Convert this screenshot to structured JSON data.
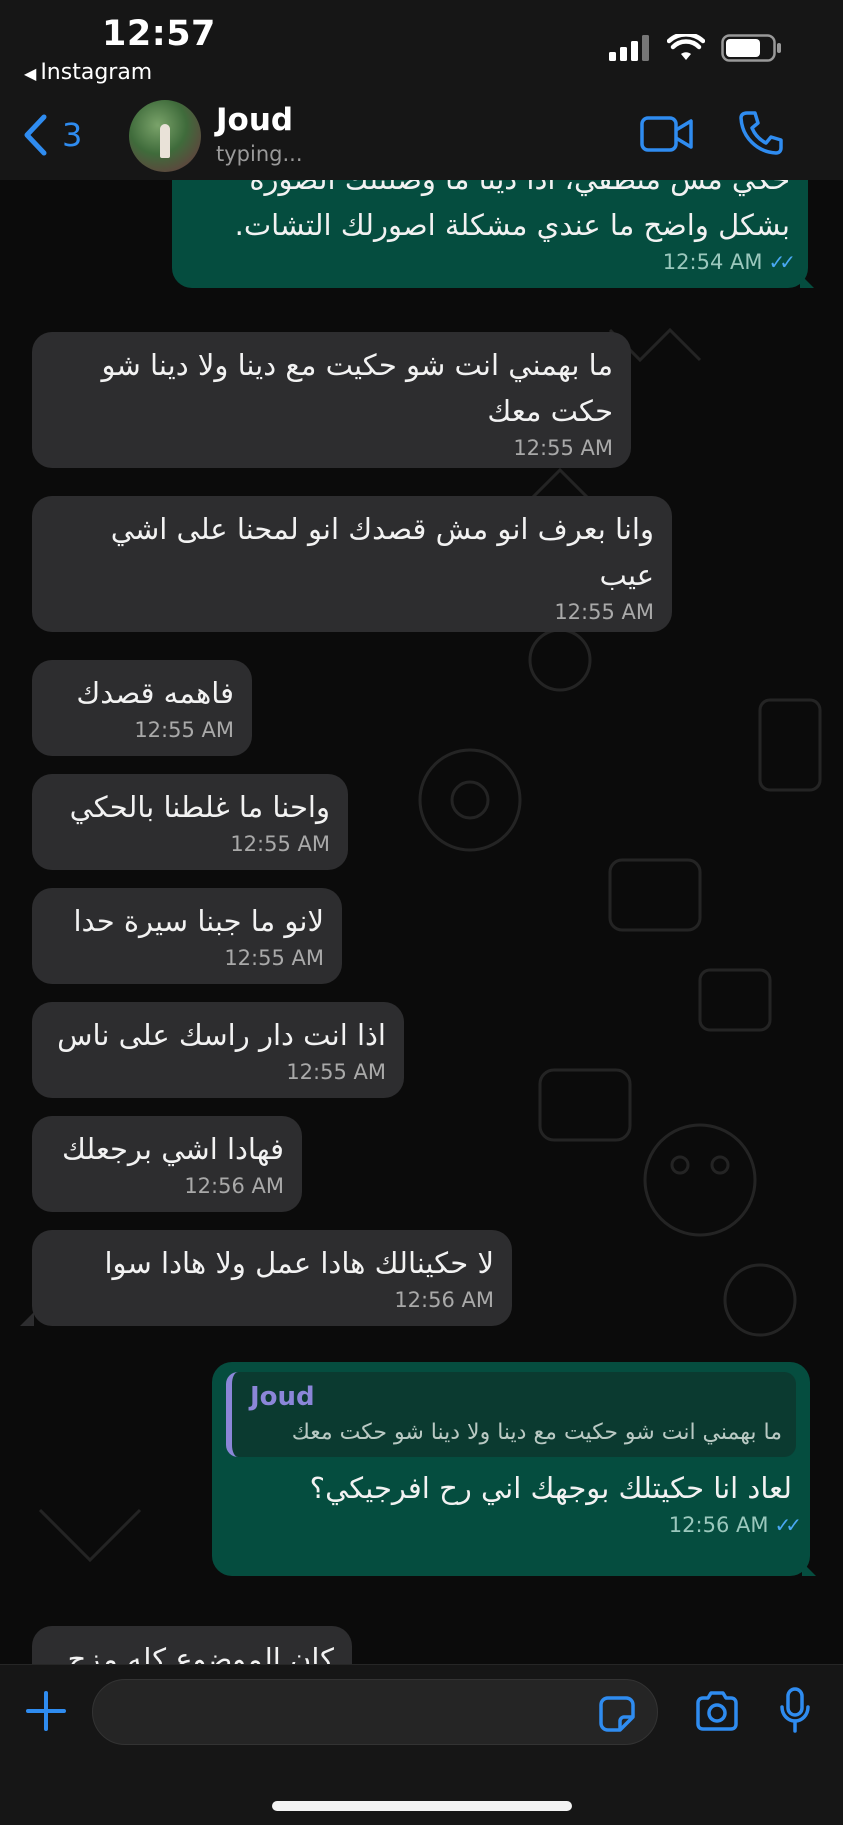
{
  "status_bar": {
    "time": "12:57",
    "back_app": "Instagram"
  },
  "header": {
    "back_count": "3",
    "contact_name": "Joud",
    "contact_status": "typing..."
  },
  "messages": [
    {
      "dir": "out",
      "text": "حكي مش منطقي، اذا دينا ما وصلتلك الصوره بشكل واضح ما عندي مشكلة اصورلك التشات.",
      "time": "12:54 AM"
    },
    {
      "dir": "in",
      "text": "ما بهمني انت شو حكيت مع دينا ولا دينا شو حكت معك",
      "time": "12:55 AM"
    },
    {
      "dir": "in",
      "text": "وانا بعرف انو مش قصدك انو لمحنا على اشي عيب",
      "time": "12:55 AM"
    },
    {
      "dir": "in",
      "text": "فاهمه قصدك",
      "time": "12:55 AM"
    },
    {
      "dir": "in",
      "text": "واحنا ما غلطنا بالحكي",
      "time": "12:55 AM"
    },
    {
      "dir": "in",
      "text": "لانو ما جبنا سيرة حدا",
      "time": "12:55 AM"
    },
    {
      "dir": "in",
      "text": "اذا انت دار راسك على ناس",
      "time": "12:55 AM"
    },
    {
      "dir": "in",
      "text": "فهادا اشي برجعلك",
      "time": "12:56 AM"
    },
    {
      "dir": "in",
      "text": "لا حكينالك هادا عمل ولا هادا سوا",
      "time": "12:56 AM"
    },
    {
      "dir": "out",
      "quote_name": "Joud",
      "quote_text": "ما بهمني انت شو حكيت مع دينا ولا دينا شو حكت معك",
      "text": "لعاد انا حكيتلك بوجهك اني رح افرجيكي؟",
      "time": "12:56 AM"
    },
    {
      "dir": "in",
      "text": "كان الموضوع كله مزح",
      "time": ""
    }
  ],
  "colors": {
    "accent": "#2f8cf0",
    "incoming_bubble": "#2d2d2f",
    "outgoing_bubble": "#054d3f",
    "read_ticks": "#4aa8f3",
    "quote_name": "#8b86d8"
  },
  "icons": [
    "back-chevron-icon",
    "video-call-icon",
    "phone-icon",
    "plus-icon",
    "sticker-icon",
    "camera-icon",
    "microphone-icon",
    "signal-icon",
    "wifi-icon",
    "battery-icon"
  ]
}
